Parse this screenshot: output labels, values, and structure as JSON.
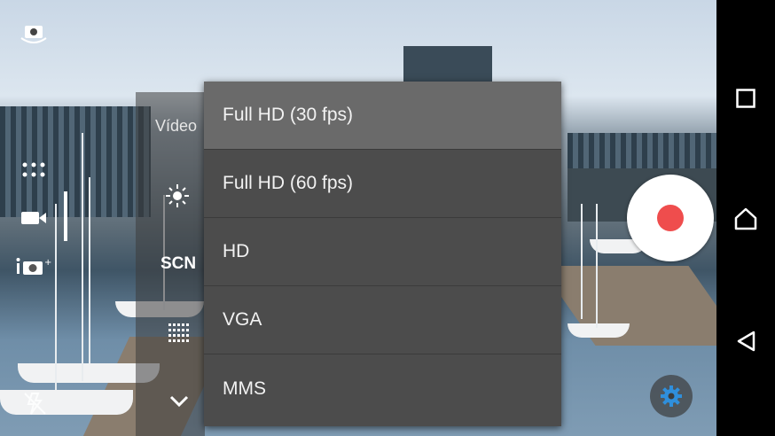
{
  "camera": {
    "mode_label": "Vídeo",
    "scene_label": "SCN"
  },
  "resolution_menu": {
    "selected_index": 0,
    "items": [
      {
        "label": "Full HD (30 fps)"
      },
      {
        "label": "Full HD (60 fps)"
      },
      {
        "label": "HD"
      },
      {
        "label": "VGA"
      },
      {
        "label": "MMS"
      }
    ]
  },
  "colors": {
    "record_dot": "#ef4d4d",
    "settings_gear": "#2f8fdc",
    "menu_bg": "#4c4c4c",
    "menu_selected": "#6a6a6a"
  },
  "icons": [
    "switch-camera-icon",
    "grid-apps-icon",
    "video-camera-icon",
    "photo-camera-icon",
    "flash-off-icon",
    "brightness-icon",
    "scene-icon",
    "grid-icon",
    "chevron-down-icon",
    "record-button",
    "settings-gear-icon",
    "recent-apps-icon",
    "home-icon",
    "back-icon"
  ]
}
